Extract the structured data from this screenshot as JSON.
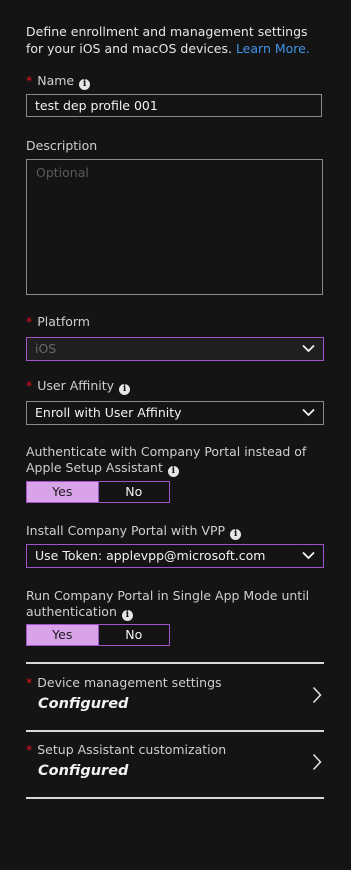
{
  "intro": {
    "text": "Define enrollment and management settings for your iOS and macOS devices.",
    "link": "Learn More."
  },
  "name": {
    "label": "Name",
    "value": "test dep profile 001"
  },
  "description": {
    "label": "Description",
    "placeholder": "Optional"
  },
  "platform": {
    "label": "Platform",
    "value": "iOS"
  },
  "user_affinity": {
    "label": "User Affinity",
    "value": "Enroll with User Affinity"
  },
  "company_portal_auth": {
    "label": "Authenticate with Company Portal instead of Apple Setup Assistant",
    "yes": "Yes",
    "no": "No",
    "selected": "Yes"
  },
  "vpp": {
    "label": "Install Company Portal with VPP",
    "value": "Use Token: applevpp@microsoft.com"
  },
  "single_app_mode": {
    "label": "Run Company Portal in Single App Mode until authentication",
    "yes": "Yes",
    "no": "No",
    "selected": "Yes"
  },
  "nav": [
    {
      "title": "Device management settings",
      "value": "Configured"
    },
    {
      "title": "Setup Assistant customization",
      "value": "Configured"
    }
  ],
  "colors": {
    "accent_purple": "#9f55c8",
    "toggle_on": "#d9a3ea",
    "required": "#e81123",
    "link": "#3f93e8"
  }
}
